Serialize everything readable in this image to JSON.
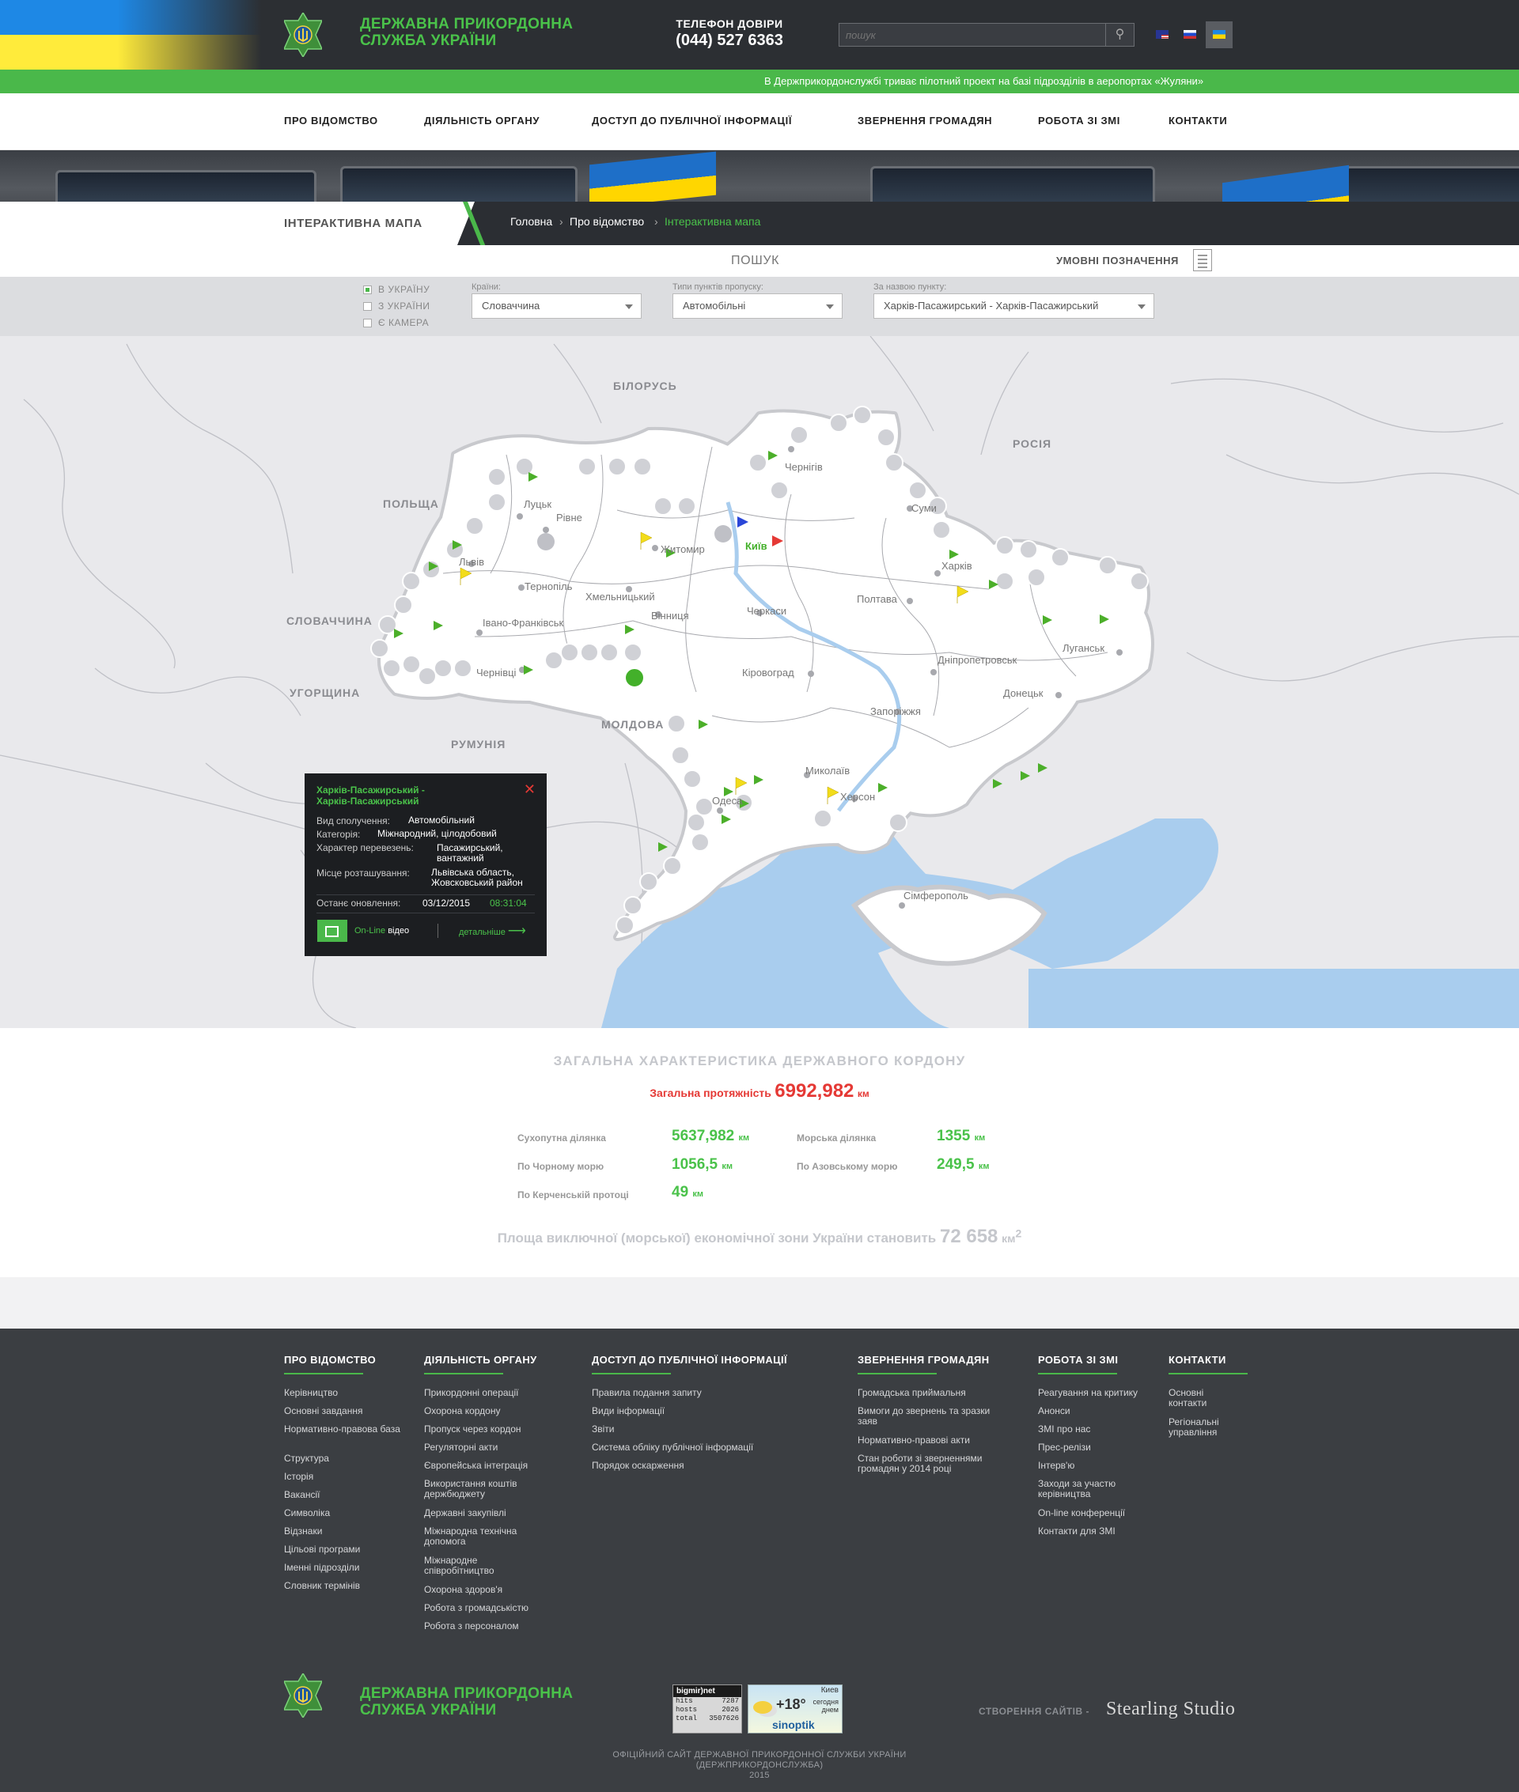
{
  "header": {
    "org_name_line1": "ДЕРЖАВНА ПРИКОРДОННА",
    "org_name_line2": "СЛУЖБА УКРАЇНИ",
    "phone_label": "ТЕЛЕФОН ДОВІРИ",
    "phone_number": "(044) 527 6363",
    "search_placeholder": "пошук",
    "search_icon": "search-icon",
    "languages": [
      {
        "code": "en",
        "icon": "us-flag-icon"
      },
      {
        "code": "ru",
        "icon": "ru-flag-icon"
      },
      {
        "code": "uk",
        "icon": "ua-flag-icon",
        "active": true
      }
    ]
  },
  "ticker": {
    "text": "В Держприкордонслужбі триває пілотний проект на базі підрозділів в аеропортах «Жуляни»"
  },
  "nav": {
    "items": [
      "ПРО ВІДОМСТВО",
      "ДІЯЛЬНІСТЬ ОРГАНУ",
      "ДОСТУП ДО ПУБЛІЧНОЇ ІНФОРМАЦІЇ",
      "ЗВЕРНЕННЯ ГРОМАДЯН",
      "РОБОТА ЗІ ЗМІ",
      "КОНТАКТИ"
    ]
  },
  "page": {
    "section_title": "ІНТЕРАКТИВНА МАПА",
    "breadcrumb": [
      "Головна",
      "Про відомство",
      "Інтерактивна мапа"
    ],
    "breadcrumb_sep": "›"
  },
  "map_tabs": {
    "search": "ПОШУК",
    "legend": "УМОВНІ ПОЗНАЧЕННЯ"
  },
  "filters": {
    "radios": [
      {
        "label": "В УКРАЇНУ",
        "checked": true
      },
      {
        "label": "З УКРАЇНИ",
        "checked": false
      },
      {
        "label": "Є КАМЕРА",
        "checked": false
      }
    ],
    "country_label": "Країни:",
    "country_value": "Словаччина",
    "type_label": "Типи пунктів пропуску:",
    "type_value": "Автомобільні",
    "name_label": "За назвою пункту:",
    "name_value": "Харків-Пасажирський - Харків-Пасажирський"
  },
  "map": {
    "countries": [
      "БІЛОРУСЬ",
      "РОСІЯ",
      "ПОЛЬЩА",
      "СЛОВАЧЧИНА",
      "УГОРЩИНА",
      "МОЛДОВА",
      "РУМУНІЯ"
    ],
    "cities": [
      "Луцьк",
      "Рівне",
      "Львів",
      "Житомир",
      "Київ",
      "Чернігів",
      "Суми",
      "Харків",
      "Тернопіль",
      "Хмельницький",
      "Вінниця",
      "Черкаси",
      "Полтава",
      "Івано-Франківськ",
      "Чернівці",
      "Кіровоград",
      "Дніпропетровськ",
      "Луганськ",
      "Донецьк",
      "Запоріжжя",
      "Миколаїв",
      "Одеса",
      "Херсон",
      "Сімферополь"
    ],
    "colors": {
      "land": "#ffffff",
      "border": "#c8c9cd",
      "sea": "#a9cdee",
      "flag_green": "#4caf2a",
      "flag_yellow": "#f2dc1b",
      "flag_red": "#e53935",
      "flag_blue": "#2a46d8"
    }
  },
  "popup": {
    "title_line1": "Харків-Пасажирський -",
    "title_line2": "Харків-Пасажирський",
    "close_icon": "close-icon",
    "rows": [
      {
        "label": "Вид сполучення:",
        "value": "Автомобільний",
        "value2": ""
      },
      {
        "label": "Категорія:",
        "value": "Міжнародний, цілодобовий",
        "value2": ""
      },
      {
        "label": "Характер перевезень:",
        "value": "Пасажирський,",
        "value2": "вантажний"
      },
      {
        "label": "Місце розташування:",
        "value": "Львівська область,",
        "value2": "Жовсковський район"
      }
    ],
    "updated_label": "Останє оновлення:",
    "updated_date": "03/12/2015",
    "updated_time": "08:31:04",
    "video_online": "On-Line",
    "video_label": "відео",
    "details": "детальніше"
  },
  "stats": {
    "title": "ЗАГАЛЬНА ХАРАКТЕРИСТИКА ДЕРЖАВНОГО КОРДОНУ",
    "total_label": "Загальна протяжність",
    "total_value": "6992,982",
    "unit": "км",
    "items": [
      {
        "label": "Сухопутна ділянка",
        "value": "5637,982"
      },
      {
        "label": "Морська ділянка",
        "value": "1355"
      },
      {
        "label": "По Чорному морю",
        "value": "1056,5"
      },
      {
        "label": "По Азовському морю",
        "value": "249,5"
      },
      {
        "label": "По Керченській протоці",
        "value": "49"
      }
    ],
    "eez_text": "Площа виключної (морської) економічної зони України становить",
    "eez_value": "72 658",
    "eez_unit": "км",
    "eez_sup": "2"
  },
  "footer": {
    "columns": [
      {
        "title": "ПРО ВІДОМСТВО",
        "items": [
          "Керівництво",
          "Основні завдання",
          "Нормативно-правова база",
          "Структура",
          "Історія",
          "Вакансії",
          "Символіка",
          "Відзнаки",
          "Цільові програми",
          "Іменні підрозділи",
          "Словник термінів"
        ]
      },
      {
        "title": "ДІЯЛЬНІСТЬ ОРГАНУ",
        "items": [
          "Прикордонні операції",
          "Охорона кордону",
          "Пропуск через кордон",
          "Регуляторні акти",
          "Європейська інтеграція",
          "Використання коштів держбюджету",
          "Державні закупівлі",
          "Міжнародна технічна допомога",
          "Міжнародне співробітництво",
          "Охорона здоров'я",
          "Робота з громадськістю",
          "Робота з персоналом"
        ]
      },
      {
        "title": "ДОСТУП ДО ПУБЛІЧНОЇ ІНФОРМАЦІЇ",
        "items": [
          "Правила подання запиту",
          "Види інформації",
          "Звіти",
          "Система обліку публічної інформації",
          "Порядок оскарження"
        ]
      },
      {
        "title": "ЗВЕРНЕННЯ ГРОМАДЯН",
        "items": [
          "Громадська приймальня",
          "Вимоги до звернень та зразки заяв",
          "Нормативно-правові акти",
          "Стан роботи зі зверненнями громадян у 2014 році"
        ]
      },
      {
        "title": "РОБОТА ЗІ ЗМІ",
        "items": [
          "Реагування на критику",
          "Анонси",
          "ЗМІ про нас",
          "Прес-релізи",
          "Інтерв'ю",
          "Заходи за участю керівництва",
          "On-line конференції",
          "Контакти для ЗМІ"
        ]
      },
      {
        "title": "КОНТАКТИ",
        "items": [
          "Основні контакти",
          "Регіональні управління"
        ]
      }
    ],
    "org_name_line1": "ДЕРЖАВНА ПРИКОРДОННА",
    "org_name_line2": "СЛУЖБА УКРАЇНИ",
    "bigmir": {
      "title": "bigmir)net",
      "hits_label": "hits",
      "hits": "7287",
      "hosts_label": "hosts",
      "hosts": "2026",
      "total_label": "total",
      "total": "3507626"
    },
    "weather": {
      "city": "Киев",
      "temp": "+18°",
      "when1": "сегодня",
      "when2": "днем",
      "brand": "sinoptik"
    },
    "made_by": "СТВОРЕННЯ САЙТІВ -",
    "studio": "Stearling Studio",
    "copyright_line1": "ОФІЦІЙНИЙ САЙТ ДЕРЖАВНОЇ ПРИКОРДОННОЇ СЛУЖБИ УКРАЇНИ",
    "copyright_line2": "(ДЕРЖПРИКОРДОНСЛУЖБА)",
    "year": "2015"
  }
}
